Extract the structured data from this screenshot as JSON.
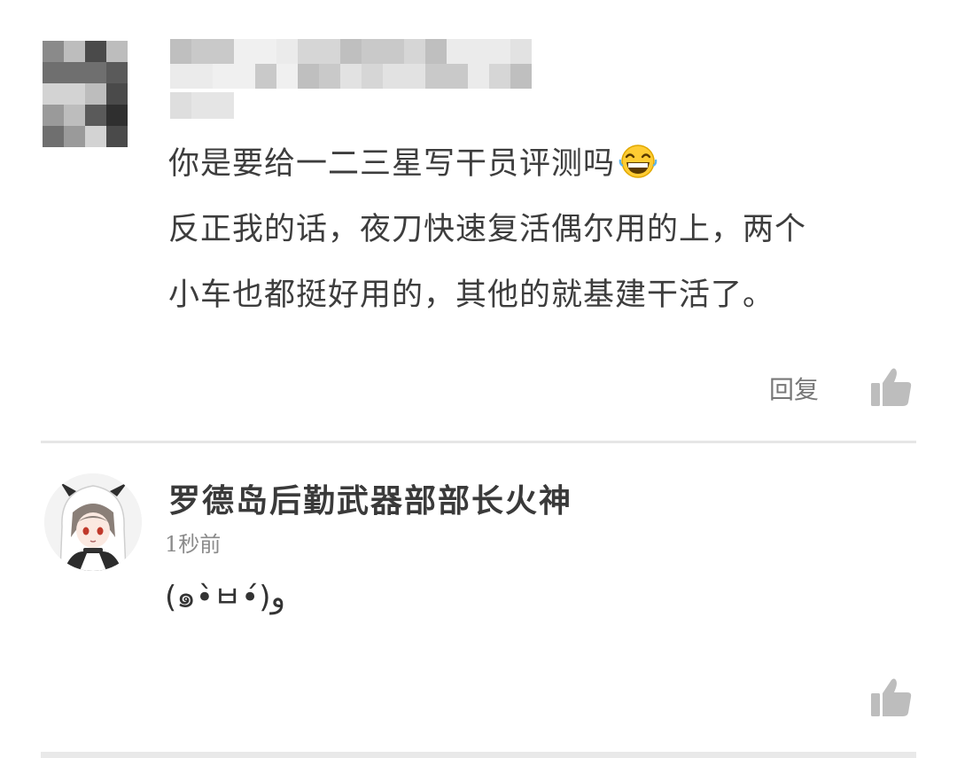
{
  "comment_1": {
    "lines": [
      "你是要给一二三星写干员评测吗",
      "反正我的话，夜刀快速复活偶尔用的上，两个",
      "小车也都挺好用的，其他的就基建干活了。"
    ],
    "emoji": "grinning-squinting-face-icon",
    "reply_label": "回复"
  },
  "comment_2": {
    "username": "罗德岛后勤武器部部长火神",
    "time": "1秒前",
    "text": "(๑•̀ㅂ•́)و"
  },
  "colors": {
    "text": "#3d3d3d",
    "muted": "#8a8a8a",
    "divider": "#e6e6e6",
    "icon": "#bdbdbd",
    "emoji_yellow": "#ffcc33"
  }
}
